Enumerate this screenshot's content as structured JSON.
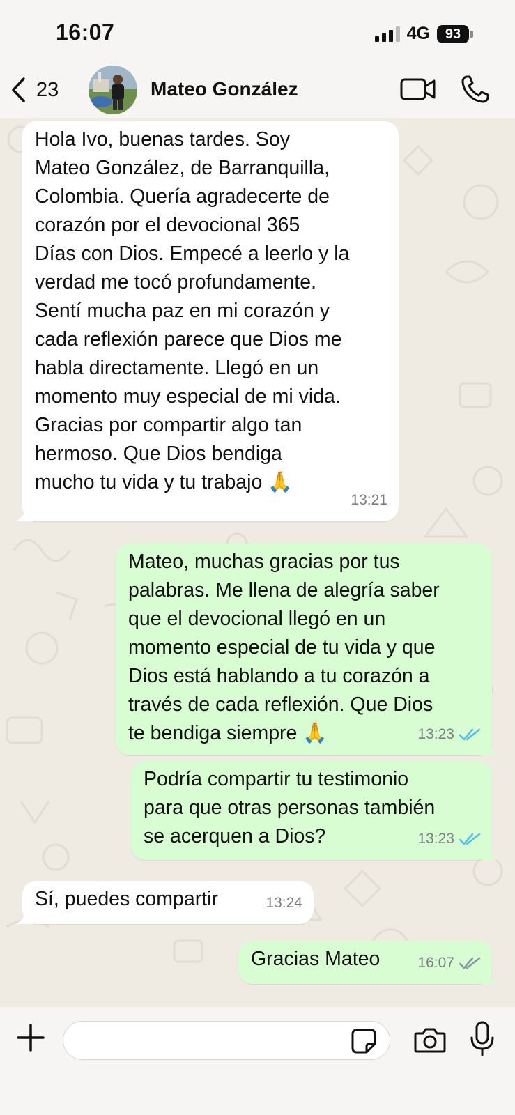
{
  "status_bar": {
    "time": "16:07",
    "network": "4G",
    "battery": "93"
  },
  "header": {
    "back_count": "23",
    "contact_name": "Mateo González"
  },
  "messages": [
    {
      "direction": "incoming",
      "text": "Hola Ivo, buenas tardes. Soy\nMateo González, de Barranquilla,\nColombia. Quería agradecerte de\ncorazón por el devocional 365\nDías con Dios. Empecé a leerlo y la\nverdad me tocó profundamente.\nSentí mucha paz en mi corazón y\ncada reflexión parece que Dios me\nhabla directamente. Llegó en un\nmomento muy especial de mi vida.\nGracias por compartir algo tan\nhermoso. Que Dios bendiga\nmucho tu vida y tu trabajo 🙏",
      "time": "13:21"
    },
    {
      "direction": "outgoing",
      "text": "Mateo, muchas gracias por tus\npalabras. Me llena de alegría saber\nque el devocional llegó en un\nmomento especial de tu vida y que\nDios está hablando a tu corazón a\ntravés de cada reflexión. Que Dios\nte bendiga siempre 🙏",
      "time": "13:23",
      "status": "read"
    },
    {
      "direction": "outgoing",
      "text": "Podría compartir tu testimonio\npara que otras personas también\nse acerquen a Dios?",
      "time": "13:23",
      "status": "read"
    },
    {
      "direction": "incoming",
      "text": "Sí, puedes compartir",
      "time": "13:24"
    },
    {
      "direction": "outgoing",
      "text": "Gracias Mateo",
      "time": "16:07",
      "status": "delivered"
    }
  ],
  "composer": {
    "value": ""
  },
  "colors": {
    "incoming_bubble": "#ffffff",
    "outgoing_bubble": "#d9fdd3",
    "read_ticks": "#53bdeb",
    "delivered_ticks": "#8696a0",
    "chat_background": "#efeae2"
  },
  "icons": [
    "back-chevron-icon",
    "video-call-icon",
    "phone-icon",
    "plus-icon",
    "sticker-icon",
    "camera-icon",
    "microphone-icon",
    "double-check-icon"
  ]
}
